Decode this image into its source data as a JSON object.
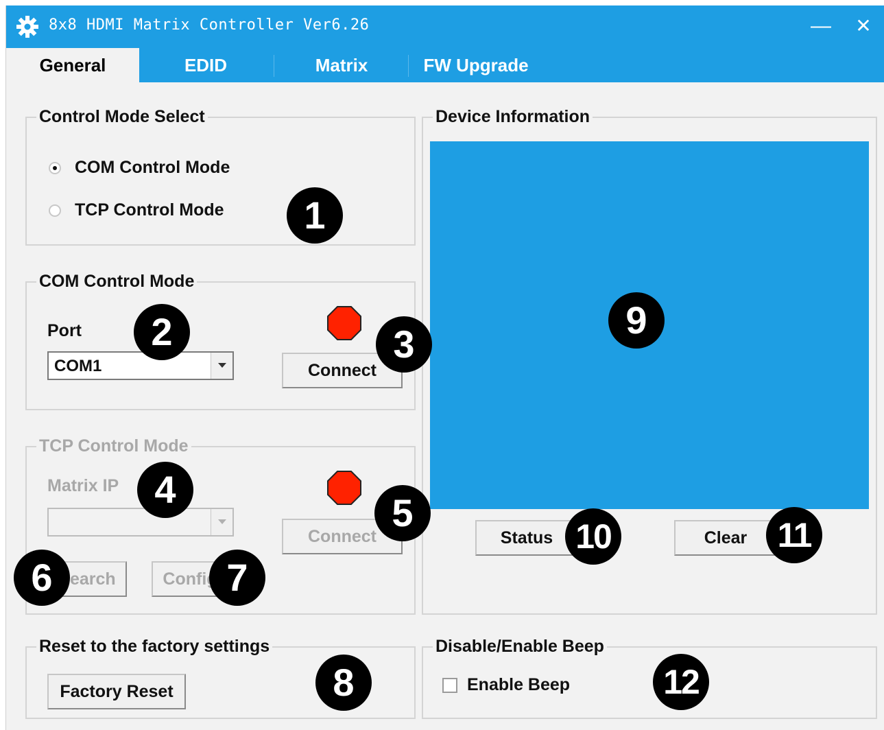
{
  "window": {
    "title": "8x8 HDMI Matrix Controller Ver6.26",
    "minimize": "—",
    "close": "✕"
  },
  "tabs": [
    {
      "label": "General",
      "active": true
    },
    {
      "label": "EDID",
      "active": false
    },
    {
      "label": "Matrix",
      "active": false
    },
    {
      "label": "FW Upgrade",
      "active": false
    }
  ],
  "control_mode_select": {
    "title": "Control Mode Select",
    "options": [
      {
        "label": "COM Control Mode",
        "checked": true
      },
      {
        "label": "TCP Control Mode",
        "checked": false
      }
    ]
  },
  "com_control": {
    "title": "COM Control Mode",
    "port_label": "Port",
    "port_value": "COM1",
    "connect_label": "Connect",
    "status_color": "#ff2200"
  },
  "tcp_control": {
    "title": "TCP Control Mode",
    "ip_label": "Matrix  IP",
    "ip_value": "",
    "connect_label": "Connect",
    "search_label": "Search",
    "config_label": "Config",
    "status_color": "#ff2200"
  },
  "device_info": {
    "title": "Device Information",
    "status_label": "Status",
    "clear_label": "Clear",
    "panel_color": "#1e9ee3"
  },
  "reset": {
    "title": "Reset to the factory settings",
    "button_label": "Factory Reset"
  },
  "beep": {
    "title": "Disable/Enable Beep",
    "checkbox_label": "Enable Beep",
    "checked": false
  },
  "callouts": [
    "1",
    "2",
    "3",
    "4",
    "5",
    "6",
    "7",
    "8",
    "9",
    "10",
    "11",
    "12"
  ]
}
